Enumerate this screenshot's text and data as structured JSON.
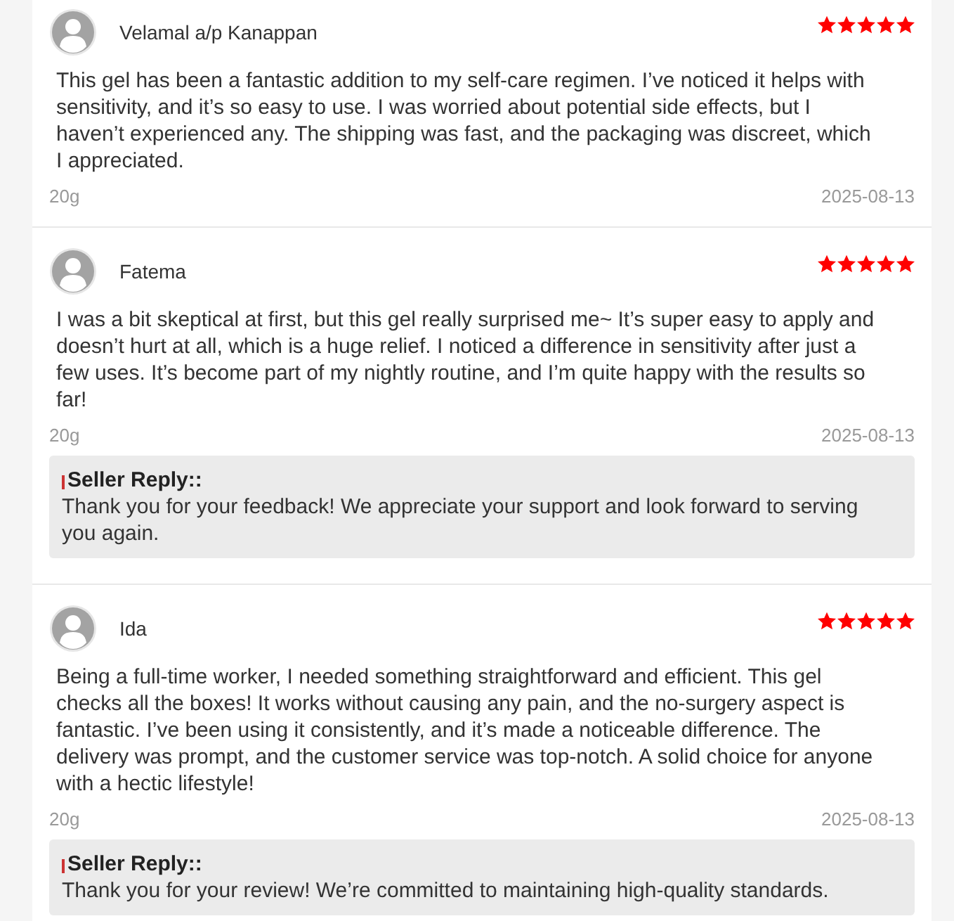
{
  "reviews": [
    {
      "user": "Velamal a/p Kanappan",
      "stars": 5,
      "text": "This gel has been a fantastic addition to my self-care regimen. I’ve noticed it helps with sensitivity, and it’s so easy to use. I was worried about potential side effects, but I haven’t experienced any. The shipping was fast, and the packaging was discreet, which I appreciated.",
      "variant": "20g",
      "date": "2025-08-13"
    },
    {
      "user": "Fatema",
      "stars": 5,
      "text": "I was a bit skeptical at first, but this gel really surprised me~ It’s super easy to apply and doesn’t hurt at all, which is a huge relief. I noticed a difference in sensitivity after just a few uses. It’s become part of my nightly routine, and I’m quite happy with the results so far!",
      "variant": "20g",
      "date": "2025-08-13",
      "seller_reply": {
        "label": "Seller Reply::",
        "text": "Thank you for your feedback! We appreciate your support and look forward to serving you again."
      }
    },
    {
      "user": "Ida",
      "stars": 5,
      "text": "Being a full-time worker, I needed something straightforward and efficient. This gel checks all the boxes! It works without causing any pain, and the no-surgery aspect is fantastic. I’ve been using it consistently, and it’s made a noticeable difference. The delivery was prompt, and the customer service was top-notch. A solid choice for anyone with a hectic lifestyle!",
      "variant": "20g",
      "date": "2025-08-13",
      "seller_reply": {
        "label": "Seller Reply::",
        "text": "Thank you for your review! We’re committed to maintaining high-quality standards."
      }
    }
  ]
}
